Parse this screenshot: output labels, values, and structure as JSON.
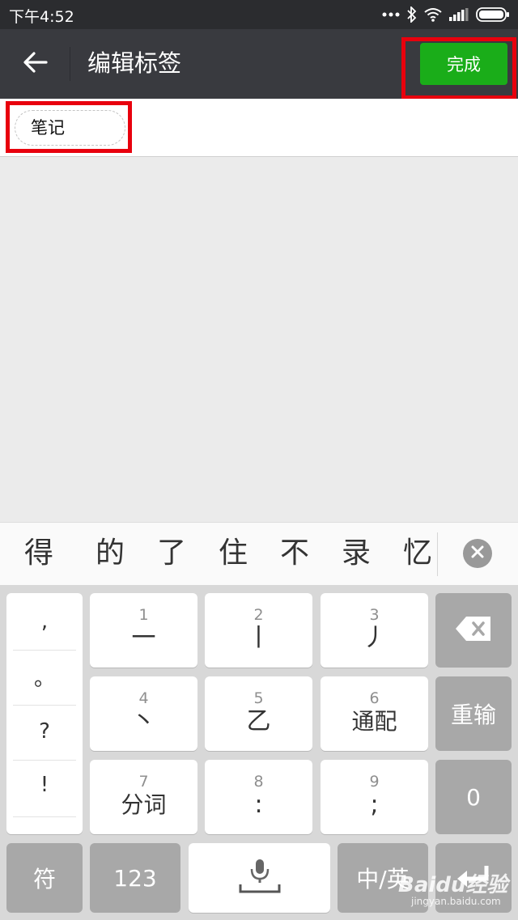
{
  "status_bar": {
    "time": "下午4:52",
    "icons": [
      "more-dots-icon",
      "bluetooth-icon",
      "wifi-icon",
      "signal-icon",
      "battery-icon"
    ]
  },
  "header": {
    "title": "编辑标签",
    "done_label": "完成",
    "back_icon": "arrow-left-icon"
  },
  "tags": {
    "items": [
      {
        "label": "笔记"
      }
    ]
  },
  "ime": {
    "candidates": [
      "得",
      "的",
      "了",
      "住",
      "不",
      "录",
      "忆"
    ],
    "punctuation": [
      ",",
      "。",
      "?",
      "!"
    ],
    "keys": {
      "k1": {
        "num": "1",
        "char": "一"
      },
      "k2": {
        "num": "2",
        "char": "丨"
      },
      "k3": {
        "num": "3",
        "char": "丿"
      },
      "k4": {
        "num": "4",
        "char": "丶"
      },
      "k5": {
        "num": "5",
        "char": "乙"
      },
      "k6": {
        "num": "6",
        "char": "通配"
      },
      "k7": {
        "num": "7",
        "char": "分词"
      },
      "k8": {
        "num": "8",
        "char": ":"
      },
      "k9": {
        "num": "9",
        "char": ";"
      }
    },
    "reinput_label": "重输",
    "zero_label": "0",
    "symbols_label": "符",
    "numbers_label": "123",
    "lang_label": "中/英"
  },
  "watermark": {
    "brand": "Baidu经验",
    "url": "jingyan.baidu.com"
  },
  "colors": {
    "titlebar": "#393a3f",
    "accent_green": "#1aad19",
    "highlight_red": "#e8000d"
  }
}
